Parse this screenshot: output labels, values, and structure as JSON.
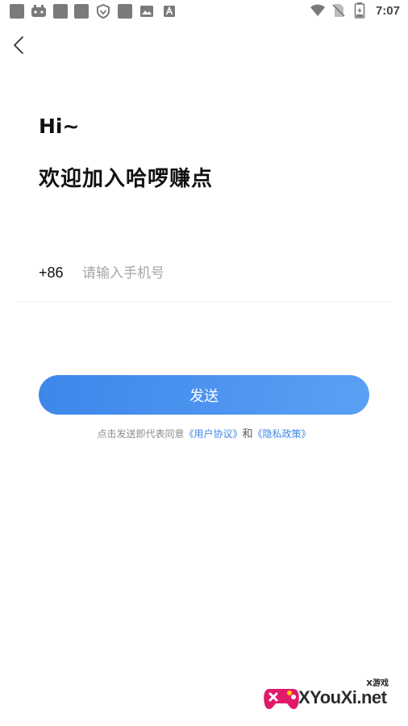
{
  "status_bar": {
    "time": "7:07",
    "battery_level": "2",
    "icons": [
      "notification-square-icon",
      "game-controller-icon",
      "notification-square-icon",
      "notification-square-icon",
      "shield-icon",
      "notification-square-icon",
      "image-icon",
      "font-icon",
      "wifi-icon",
      "no-sim-icon",
      "battery-charging-icon"
    ]
  },
  "nav": {
    "back_icon": "chevron-left-icon"
  },
  "header": {
    "greeting": "Hi~",
    "welcome": "欢迎加入哈啰赚点"
  },
  "phone": {
    "country_code": "+86",
    "placeholder": "请输入手机号",
    "value": ""
  },
  "send_button": {
    "label": "发送"
  },
  "agreement": {
    "prefix": "点击发送即代表同意",
    "user_agreement": "《用户协议》",
    "and": "和",
    "privacy_policy": "《隐私政策》"
  },
  "watermark": {
    "small_text": "X游戏",
    "main_text": "XYouXi.net"
  },
  "colors": {
    "accent": "#3d87ea",
    "button_gradient_end": "#5aa0f5",
    "placeholder": "#a6a6a6",
    "hint_text": "#8c8c8c"
  }
}
